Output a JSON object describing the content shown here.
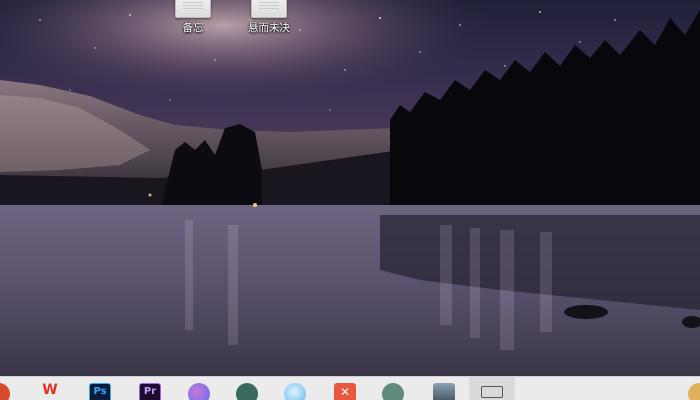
{
  "desktop": {
    "icons": [
      {
        "label": "备忘",
        "icon": "text-file-icon"
      },
      {
        "label": "悬而未决",
        "icon": "text-file-icon"
      }
    ]
  },
  "taskbar": {
    "apps": [
      {
        "name": "partial-app-icon",
        "text": ""
      },
      {
        "name": "wps-office-icon",
        "text": "W"
      },
      {
        "name": "photoshop-icon",
        "text": "Ps"
      },
      {
        "name": "premiere-icon",
        "text": "Pr"
      },
      {
        "name": "messenger-icon",
        "text": ""
      },
      {
        "name": "feather-app-icon",
        "text": ""
      },
      {
        "name": "browser-globe-icon",
        "text": ""
      },
      {
        "name": "xmind-icon",
        "text": "✕"
      },
      {
        "name": "wechat-icon",
        "text": ""
      },
      {
        "name": "photo-viewer-icon",
        "text": ""
      },
      {
        "name": "monitor-app-icon",
        "text": ""
      },
      {
        "name": "partial-tray-icon",
        "text": ""
      }
    ]
  },
  "colors": {
    "taskbar_bg": "#ecebec",
    "sky_top": "#1c1d36",
    "sky_glow": "#a88aa0",
    "water": "#5e5470"
  }
}
